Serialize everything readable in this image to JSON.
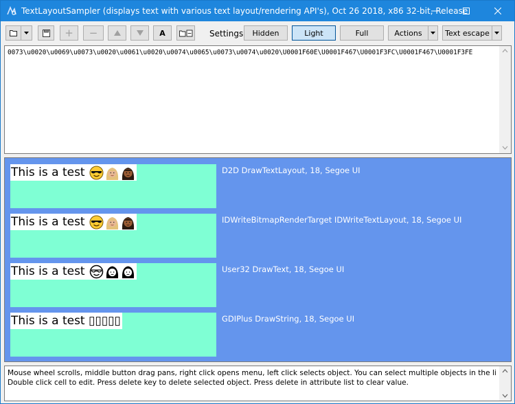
{
  "window": {
    "title": "TextLayoutSampler (displays text with various text layout/rendering API's), Oct 26 2018, x86 32-bit, Release"
  },
  "toolbar": {
    "zoom_in_label": "+",
    "zoom_out_label": "−",
    "font_label": "A",
    "settings_label": "Settings:",
    "hidden_label": "Hidden",
    "light_label": "Light",
    "full_label": "Full",
    "actions_label": "Actions",
    "text_escape_label": "Text escape"
  },
  "editor": {
    "text": "0073\\u0020\\u0069\\u0073\\u0020\\u0061\\u0020\\u0074\\u0065\\u0073\\u0074\\u0020\\U0001F60E\\U0001F467\\U0001F3FC\\U0001F467\\U0001F3FE"
  },
  "samples": [
    {
      "text": "This is a test",
      "label": "D2D DrawTextLayout, 18, Segoe UI",
      "emoji_style": "color"
    },
    {
      "text": "This is a test",
      "label": "IDWriteBitmapRenderTarget IDWriteTextLayout, 18, Segoe UI",
      "emoji_style": "color"
    },
    {
      "text": "This is a test",
      "label": "User32 DrawText, 18, Segoe UI",
      "emoji_style": "outline"
    },
    {
      "text": "This is a test ▯▯▯▯▯",
      "label": "GDIPlus DrawString, 18, Segoe UI",
      "emoji_style": "none"
    }
  ],
  "status": {
    "line1": "Mouse wheel scrolls, middle button drag pans, right click opens menu, left click selects object. You can select multiple objects in the list to",
    "line2": "Double click cell to edit. Press delete key to delete selected object. Press delete in attribute list to clear value."
  },
  "colors": {
    "titlebar": "#1e86dd",
    "render_background": "#6495ed",
    "sample_background": "#7fffd4",
    "pressed_button": "#cce4f7"
  },
  "icons": {
    "open": "folder-icon",
    "save": "save-icon",
    "move_up": "triangle-up-icon",
    "move_down": "triangle-down-icon",
    "folder_list": "folder-list-icon"
  }
}
